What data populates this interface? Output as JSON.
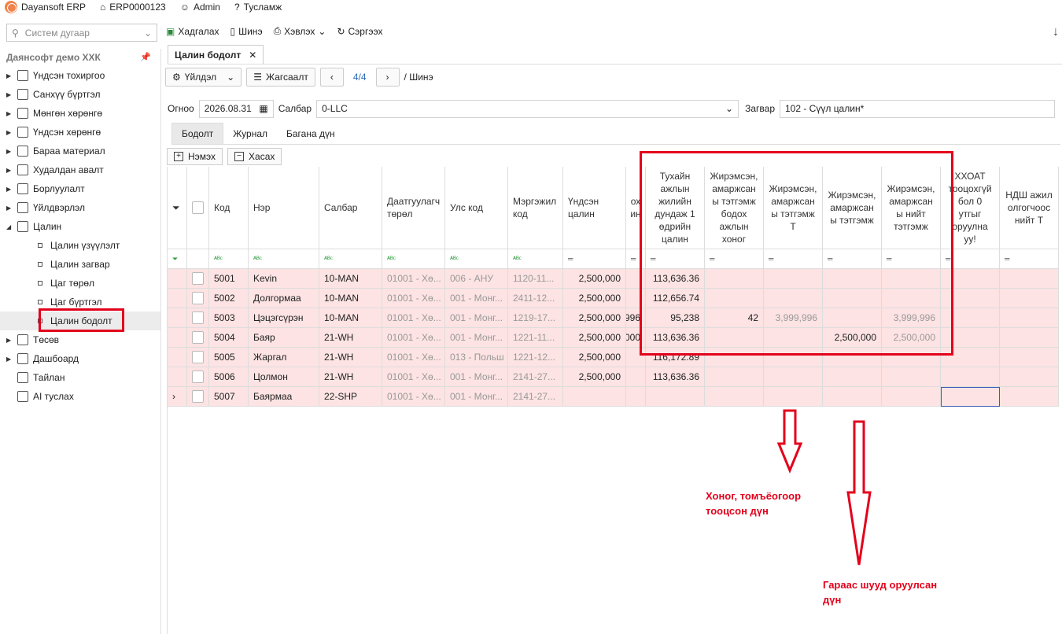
{
  "topbar": {
    "app": "Dayansoft ERP",
    "db": "ERP0000123",
    "user": "Admin",
    "help": "Тусламж"
  },
  "search": {
    "placeholder": "Систем дугаар"
  },
  "toolbar": {
    "save": "Хадгалах",
    "new": "Шинэ",
    "print": "Хэвлэх",
    "refresh": "Сэргээх"
  },
  "sidebar": {
    "company": "Даянсофт демо ХХК",
    "items": [
      {
        "label": "Үндсэн тохиргоо",
        "icon": "gear-icon"
      },
      {
        "label": "Санхүү бүртгэл",
        "icon": "ledger-icon"
      },
      {
        "label": "Мөнгөн хөрөнгө",
        "icon": "money-icon"
      },
      {
        "label": "Үндсэн хөрөнгө",
        "icon": "building-icon"
      },
      {
        "label": "Бараа материал",
        "icon": "box-icon"
      },
      {
        "label": "Худалдан авалт",
        "icon": "purchase-icon"
      },
      {
        "label": "Борлуулалт",
        "icon": "cart-icon"
      },
      {
        "label": "Үйлдвэрлэл",
        "icon": "factory-icon"
      },
      {
        "label": "Цалин",
        "icon": "calculator-icon"
      }
    ],
    "sub": [
      "Цалин үзүүлэлт",
      "Цалин загвар",
      "Цаг төрөл",
      "Цаг бүртгэл",
      "Цалин бодолт"
    ],
    "items2": [
      {
        "label": "Төсөв",
        "icon": "pie-icon"
      },
      {
        "label": "Дашбоард",
        "icon": "dashboard-icon"
      },
      {
        "label": "Тайлан",
        "icon": "report-icon"
      },
      {
        "label": "AI туслах",
        "icon": "ai-icon"
      }
    ]
  },
  "doc": {
    "tab": "Цалин бодолт",
    "action": "Үйлдэл",
    "sort": "Жагсаалт",
    "pager": "4/4",
    "mode": "/ Шинэ"
  },
  "fields": {
    "date_label": "Огноо",
    "date": "2026.08.31",
    "branch_label": "Салбар",
    "branch": "0-LLC",
    "template_label": "Загвар",
    "template": "102 - Сүүл цалин*"
  },
  "tabs": [
    "Бодолт",
    "Журнал",
    "Багана дүн"
  ],
  "rowbtns": {
    "add": "Нэмэх",
    "remove": "Хасах"
  },
  "columns": [
    "Код",
    "Нэр",
    "Салбар",
    "Даатгуулагч төрөл",
    "Улс код",
    "Мэргэжил код",
    "Үндсэн цалин",
    "ох ин",
    "Тухайн ажлын жилийн дундаж 1 өдрийн цалин",
    "Жирэмсэн, амаржсан ы тэтгэмж бодох ажлын хоног",
    "Жирэмсэн, амаржсан ы тэтгэмж Т",
    "Жирэмсэн, амаржсан ы тэтгэмж",
    "Жирэмсэн, амаржсан ы нийт тэтгэмж",
    "ХХОАТ тооцохгүй бол 0 утгыг оруулна уу!",
    "НДШ ажил олгогчоос нийт Т"
  ],
  "rows": [
    {
      "code": "5001",
      "name": "Kevin",
      "branch": "10-MAN",
      "ins": "01001 - Хө...",
      "country": "006 - АНУ",
      "prof": "1120-11...",
      "base": "2,500,000",
      "partial": "",
      "avg": "113,636.36",
      "days": "",
      "bT": "",
      "b": "",
      "total": ""
    },
    {
      "code": "5002",
      "name": "Долгормаа",
      "branch": "10-MAN",
      "ins": "01001 - Хө...",
      "country": "001 - Монг...",
      "prof": "2411-12...",
      "base": "2,500,000",
      "partial": "",
      "avg": "112,656.74",
      "days": "",
      "bT": "",
      "b": "",
      "total": ""
    },
    {
      "code": "5003",
      "name": "Цэцэгсүрэн",
      "branch": "10-MAN",
      "ins": "01001 - Хө...",
      "country": "001 - Монг...",
      "prof": "1219-17...",
      "base": "2,500,000",
      "partial": "996",
      "avg": "95,238",
      "days": "42",
      "bT": "3,999,996",
      "b": "",
      "total": "3,999,996"
    },
    {
      "code": "5004",
      "name": "Баяр",
      "branch": "21-WH",
      "ins": "01001 - Хө...",
      "country": "001 - Монг...",
      "prof": "1221-11...",
      "base": "2,500,000",
      "partial": "000",
      "avg": "113,636.36",
      "days": "",
      "bT": "",
      "b": "2,500,000",
      "total": "2,500,000"
    },
    {
      "code": "5005",
      "name": "Жаргал",
      "branch": "21-WH",
      "ins": "01001 - Хө...",
      "country": "013 - Польш",
      "prof": "1221-12...",
      "base": "2,500,000",
      "partial": "",
      "avg": "116,172.89",
      "days": "",
      "bT": "",
      "b": "",
      "total": ""
    },
    {
      "code": "5006",
      "name": "Цолмон",
      "branch": "21-WH",
      "ins": "01001 - Хө...",
      "country": "001 - Монг...",
      "prof": "2141-27...",
      "base": "2,500,000",
      "partial": "",
      "avg": "113,636.36",
      "days": "",
      "bT": "",
      "b": "",
      "total": ""
    },
    {
      "code": "5007",
      "name": "Баярмаа",
      "branch": "22-SHP",
      "ins": "01001 - Хө...",
      "country": "001 - Монг...",
      "prof": "2141-27...",
      "base": "",
      "partial": "",
      "avg": "",
      "days": "",
      "bT": "",
      "b": "",
      "total": ""
    }
  ],
  "notes": {
    "n1": "Хоног, томъёогоор тооцсон дүн",
    "n2": "Гараас шууд оруулсан дүн"
  },
  "colors": {
    "highlight": "#e3001b",
    "row": "#fde3e3"
  }
}
